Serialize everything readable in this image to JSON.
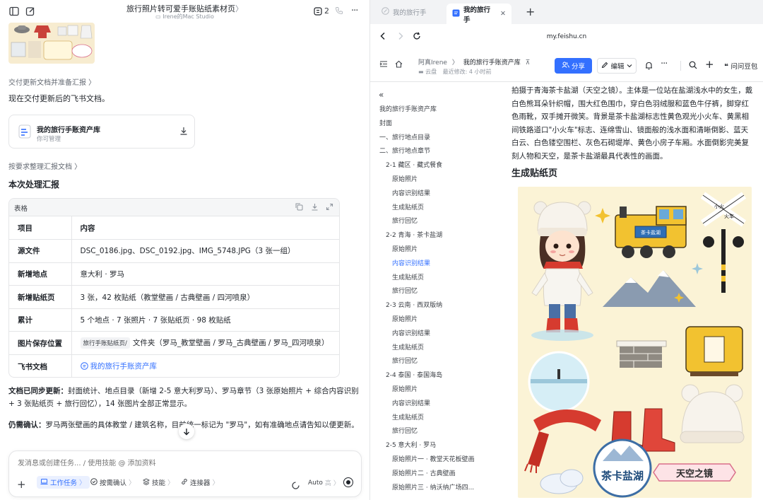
{
  "left": {
    "title": "旅行照片转可爱手账贴纸素材页",
    "title_suffix": "〉",
    "subtitle": "Irene的Mac Studio",
    "msg_count": "2",
    "step1": "交付更新文档并准备汇报 〉",
    "intro": "现在交付更新后的飞书文档。",
    "doc_card": {
      "title": "我的旅行手账资产库",
      "subtitle": "你可管理"
    },
    "step2": "按要求整理汇报文档 〉",
    "report_title": "本次处理汇报",
    "table_label": "表格",
    "table_rows": [
      {
        "key": "项目",
        "value": "内容"
      },
      {
        "key": "源文件",
        "value": "DSC_0186.jpg、DSC_0192.jpg、IMG_5748.JPG（3 张一组）"
      },
      {
        "key": "新增地点",
        "value": "意大利 · 罗马"
      },
      {
        "key": "新增贴纸页",
        "value": "3 张，42 枚贴纸（教堂壁画 / 古典壁画 / 四河喷泉）"
      },
      {
        "key": "累计",
        "value": "5 个地点 · 7 张照片 · 7 张贴纸页 · 98 枚贴纸"
      },
      {
        "key": "图片保存位置",
        "chip": "旅行手账贴纸页/",
        "value": "文件夹（罗马_教堂壁画 / 罗马_古典壁画 / 罗马_四河喷泉）"
      },
      {
        "key": "飞书文档",
        "value": "我的旅行手账资产库"
      }
    ],
    "sync_label": "文档已同步更新：",
    "sync_text": "封面统计、地点目录（新增 2-5 意大利罗马）、罗马章节（3 张原始照片 + 综合内容识别 + 3 张贴纸页 + 旅行回忆），14 张图片全部正常显示。",
    "confirm_label": "仍需确认：",
    "confirm_text": "罗马两张壁画的具体教堂 / 建筑名称，目前统一标记为 \"罗马\"，如有准确地点请告知以便更新。",
    "input_placeholder": "发消息或创建任务... / 使用技能 @ 添加资料",
    "toolbar": {
      "work_task": "工作任务",
      "confirm": "按需确认",
      "skills": "技能",
      "connector": "连接器",
      "auto": "Auto",
      "auto_level": "高"
    }
  },
  "right": {
    "tabs": [
      {
        "label": "我的旅行手"
      },
      {
        "label": "我的旅行手"
      }
    ],
    "url": "my.feishu.cn",
    "breadcrumb": {
      "owner": "阿真Irene",
      "doc": "我的旅行手账资产库",
      "location": "云盘",
      "modified": "最近修改: 4 小时前"
    },
    "share_label": "分享",
    "edit_label": "编辑",
    "ask_label": "问问豆包",
    "toc": [
      {
        "label": "我的旅行手账资产库",
        "level": 0
      },
      {
        "label": "封面",
        "level": 0
      },
      {
        "label": "一、旅行地点目录",
        "level": 0
      },
      {
        "label": "二、旅行地点章节",
        "level": 0
      },
      {
        "label": "2-1 藏区 · 藏式餐食",
        "level": 1
      },
      {
        "label": "原始照片",
        "level": 2
      },
      {
        "label": "内容识别结果",
        "level": 2
      },
      {
        "label": "生成贴纸页",
        "level": 2
      },
      {
        "label": "旅行回忆",
        "level": 2
      },
      {
        "label": "2-2 青海 · 茶卡盐湖",
        "level": 1
      },
      {
        "label": "原始照片",
        "level": 2
      },
      {
        "label": "内容识别结果",
        "level": 2,
        "active": true
      },
      {
        "label": "生成贴纸页",
        "level": 2
      },
      {
        "label": "旅行回忆",
        "level": 2
      },
      {
        "label": "2-3 云南 · 西双版纳",
        "level": 1
      },
      {
        "label": "原始照片",
        "level": 2
      },
      {
        "label": "内容识别结果",
        "level": 2
      },
      {
        "label": "生成贴纸页",
        "level": 2
      },
      {
        "label": "旅行回忆",
        "level": 2
      },
      {
        "label": "2-4 泰国 · 泰国海岛",
        "level": 1
      },
      {
        "label": "原始照片",
        "level": 2
      },
      {
        "label": "内容识别结果",
        "level": 2
      },
      {
        "label": "生成贴纸页",
        "level": 2
      },
      {
        "label": "旅行回忆",
        "level": 2
      },
      {
        "label": "2-5 意大利 · 罗马",
        "level": 1
      },
      {
        "label": "原始照片一 · 教堂天花板壁画",
        "level": 2
      },
      {
        "label": "原始照片二 · 古典壁画",
        "level": 2
      },
      {
        "label": "原始照片三 · 纳沃纳广场四...",
        "level": 2
      }
    ],
    "paragraph": "拍摄于青海茶卡盐湖（天空之镜）。主体是一位站在盐湖浅水中的女生，戴白色熊耳朵针织帽，围大红色围巾，穿白色羽绒服和蓝色牛仔裤，脚穿红色雨靴，双手摊开微笑。背景是茶卡盐湖标志性黄色观光小火车、黄黑相间铁路道口\"小火车\"标志、连绵雪山、镜面般的浅水面和清晰倒影、蓝天白云、白色镂空围栏、灰色石砌堤岸、黄色小房子车厢。水面倒影完美复刻人物和天空，是茶卡盐湖最具代表性的画面。",
    "section_heading": "生成贴纸页",
    "sticker_text": {
      "badge": "茶卡盐湖",
      "banner": "天空之镜",
      "train_sign": "茶卡盐湖",
      "crossing_a": "小火",
      "crossing_b": "火车"
    }
  }
}
